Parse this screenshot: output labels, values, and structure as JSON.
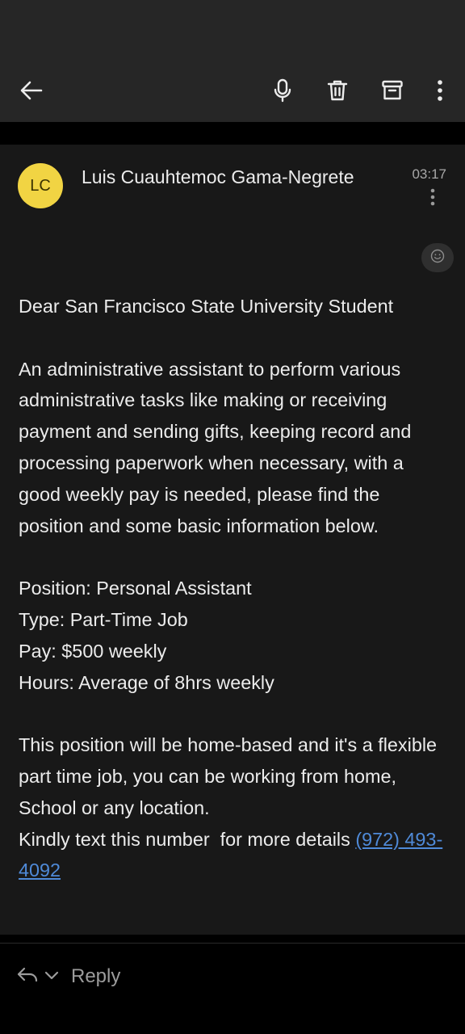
{
  "toolbar": {
    "back_icon": "arrow-left-icon",
    "mic_icon": "microphone-icon",
    "delete_icon": "trash-icon",
    "archive_icon": "archive-icon",
    "more_icon": "more-vertical-icon"
  },
  "message": {
    "avatar_initials": "LC",
    "avatar_color": "#f1d443",
    "sender": "Luis Cuauhtemoc Gama-Negrete",
    "time": "03:17",
    "greeting": "Dear San Francisco State University Student",
    "intro": "An administrative assistant to perform various administrative tasks like making or receiving payment and sending gifts, keeping record and processing paperwork when necessary, with a good weekly pay is needed, please find the position and some basic information below.",
    "details": [
      "Position: Personal Assistant",
      "Type: Part-Time Job",
      "Pay: $500 weekly",
      "Hours: Average of 8hrs weekly"
    ],
    "closing": "This position will be home-based and it's a flexible part time job, you can be working from home, School or any location.",
    "contact_text": "Kindly text this number  for more details ",
    "phone": "(972) 493-4092"
  },
  "reply_bar": {
    "label": "Reply"
  },
  "colors": {
    "background": "#000000",
    "card": "#181818",
    "topbar": "#262626",
    "link": "#4f8ad8"
  }
}
